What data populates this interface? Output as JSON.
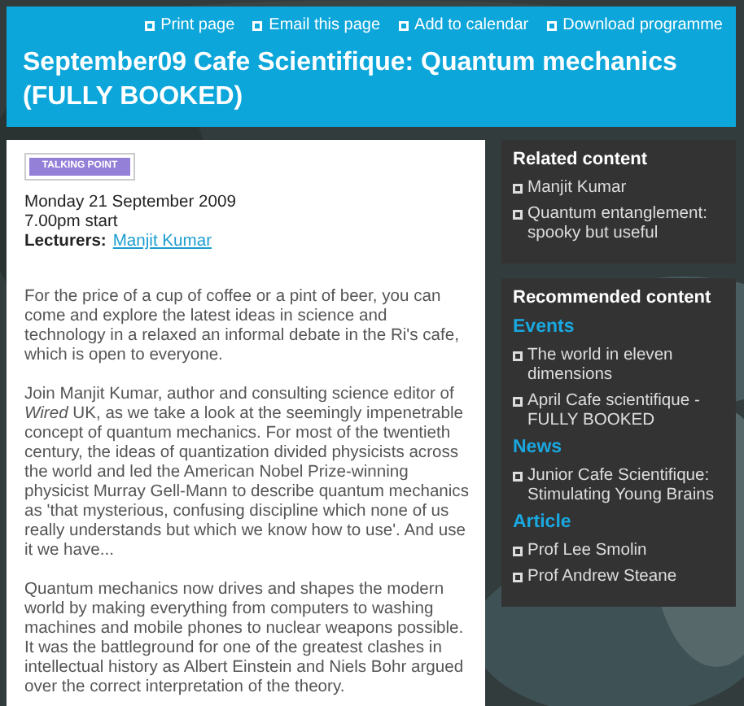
{
  "header": {
    "links": [
      "Print page",
      "Email this page",
      "Add to calendar",
      "Download programme"
    ],
    "title": "September09 Cafe Scientifique: Quantum mechanics (FULLY BOOKED)"
  },
  "main": {
    "logo": "TALKING POINT",
    "date": "Monday 21 September 2009",
    "time": "7.00pm start",
    "lecturers_label": "Lecturers:",
    "lecturers": [
      "Manjit Kumar"
    ],
    "paragraphs": [
      "For the price of a cup of coffee or a pint of beer, you can come and explore the latest ideas in science and technology in a relaxed an informal debate in the Ri's cafe, which is open to everyone.",
      "Join Manjit Kumar, author and consulting science editor of *Wired* UK, as we take a look at the seemingly impenetrable concept of quantum mechanics. For most of the twentieth century, the ideas of quantization divided physicists across the world and led the American Nobel Prize-winning physicist Murray Gell-Mann to describe quantum mechanics as 'that mysterious, confusing discipline which none of us really understands but which we know how to use'. And use it we have...",
      "Quantum mechanics now drives and shapes the modern world by making everything from computers to washing machines and mobile phones to nuclear weapons possible. It was the battleground for one of the greatest clashes in intellectual history as Albert Einstein and Niels Bohr argued over the correct interpretation of the theory."
    ]
  },
  "sidebar": [
    {
      "title": "Related content",
      "groups": [
        {
          "items": [
            "Manjit Kumar",
            "Quantum entanglement: spooky but useful"
          ]
        }
      ]
    },
    {
      "title": "Recommended content",
      "groups": [
        {
          "heading": "Events",
          "items": [
            "The world in eleven dimensions",
            "April Cafe scientifique - FULLY BOOKED"
          ]
        },
        {
          "heading": "News",
          "items": [
            "Junior Cafe Scientifique: Stimulating Young Brains"
          ]
        },
        {
          "heading": "Article",
          "items": [
            "Prof Lee Smolin",
            "Prof Andrew Steane"
          ]
        }
      ]
    }
  ]
}
